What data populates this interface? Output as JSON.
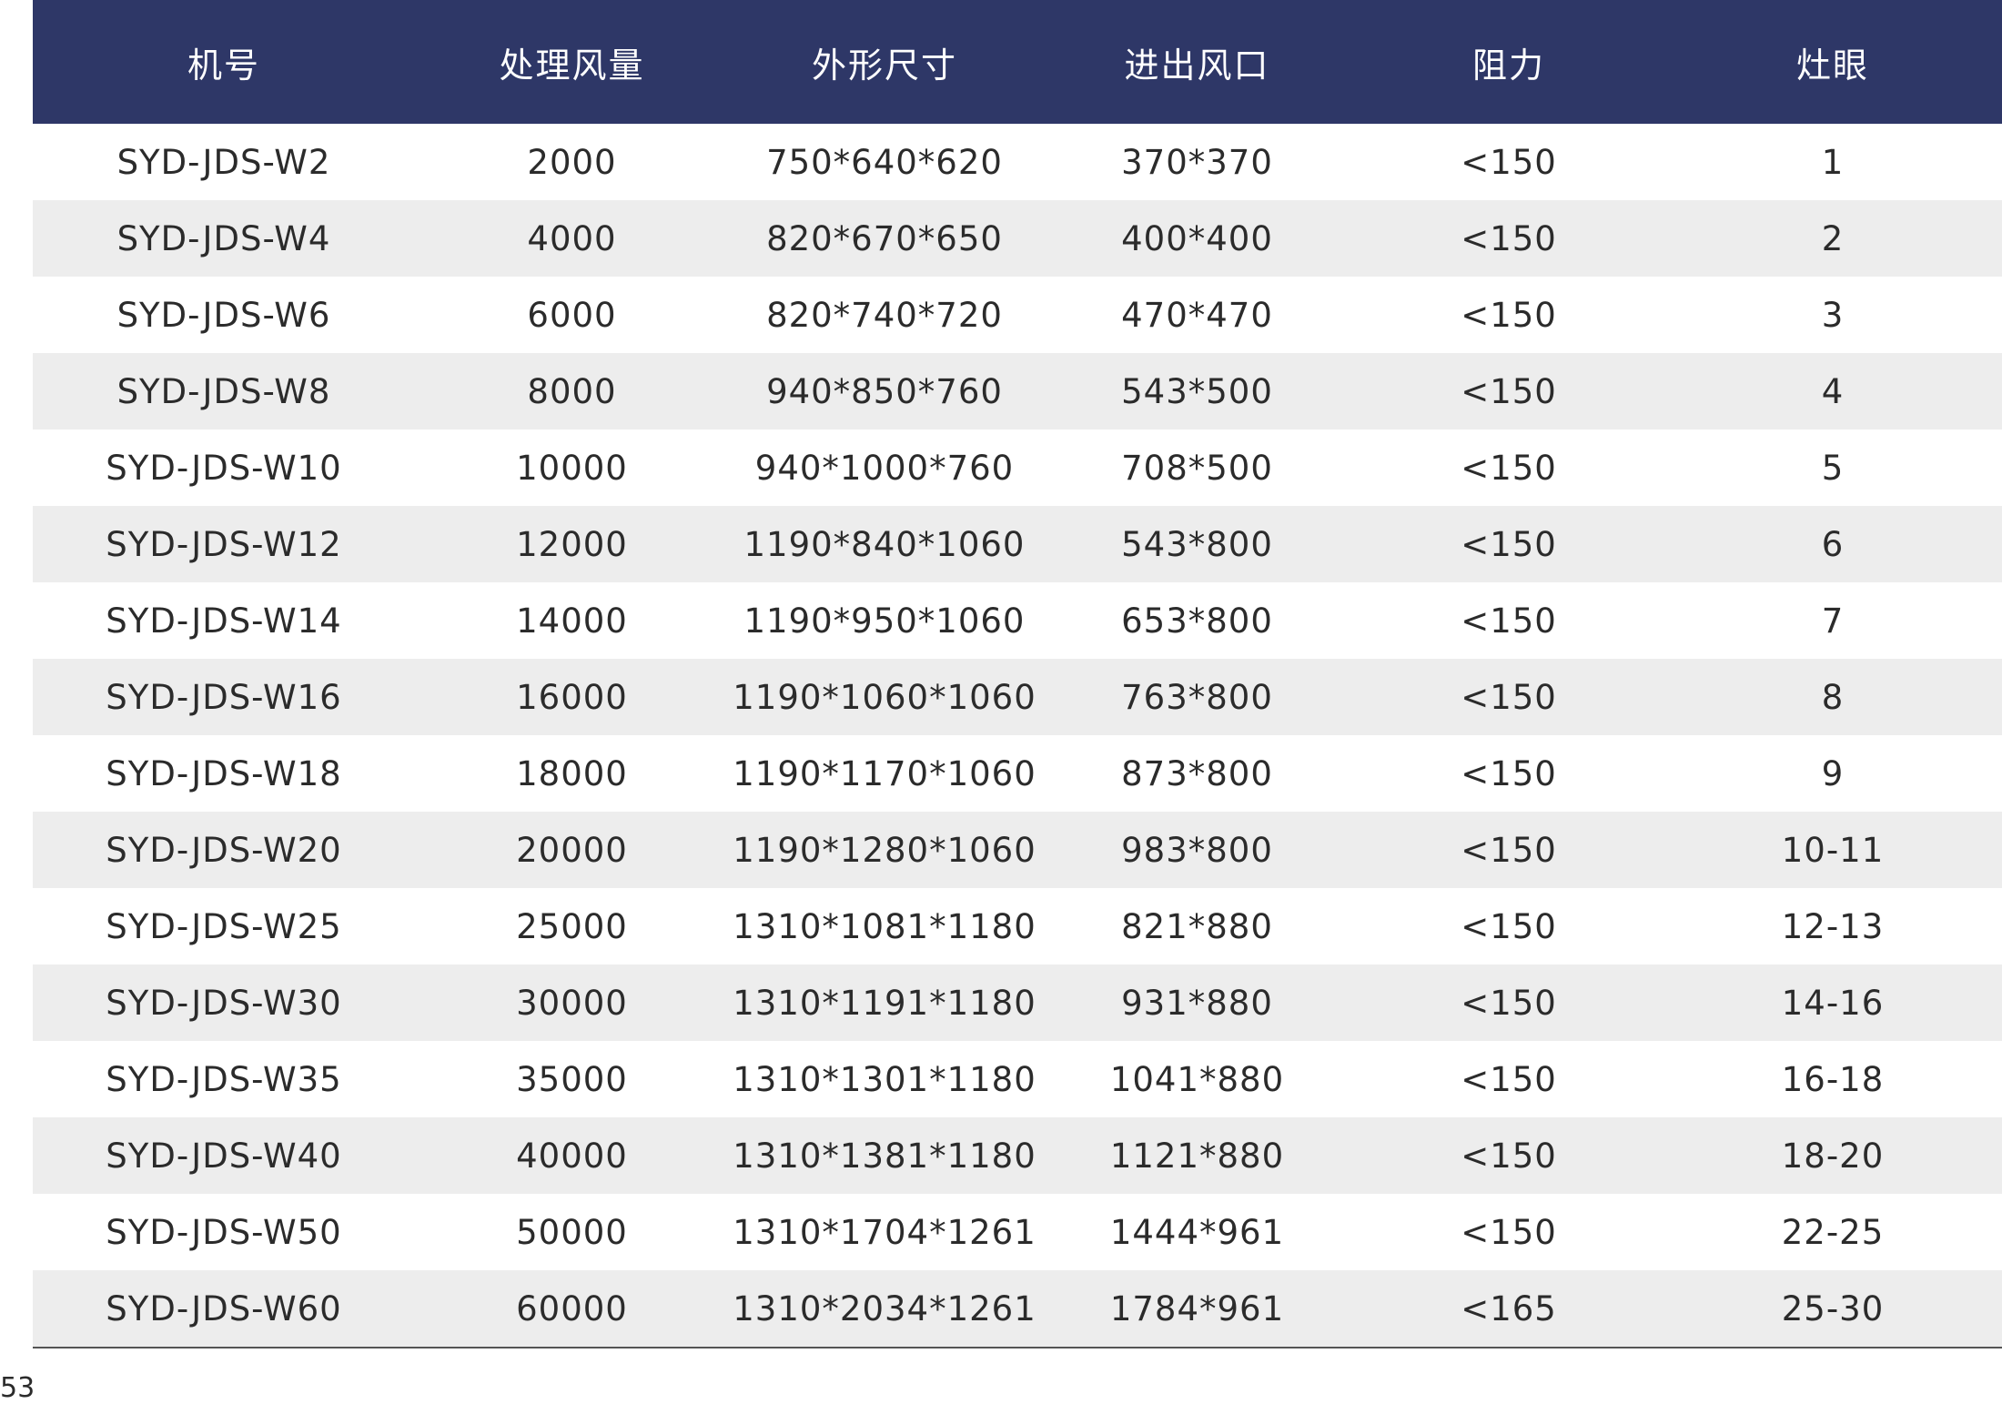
{
  "table": {
    "headers": [
      "机号",
      "处理风量",
      "外形尺寸",
      "进出风口",
      "阻力",
      "灶眼"
    ],
    "rows": [
      [
        "SYD-JDS-W2",
        "2000",
        "750*640*620",
        "370*370",
        "<150",
        "1"
      ],
      [
        "SYD-JDS-W4",
        "4000",
        "820*670*650",
        "400*400",
        "<150",
        "2"
      ],
      [
        "SYD-JDS-W6",
        "6000",
        "820*740*720",
        "470*470",
        "<150",
        "3"
      ],
      [
        "SYD-JDS-W8",
        "8000",
        "940*850*760",
        "543*500",
        "<150",
        "4"
      ],
      [
        "SYD-JDS-W10",
        "10000",
        "940*1000*760",
        "708*500",
        "<150",
        "5"
      ],
      [
        "SYD-JDS-W12",
        "12000",
        "1190*840*1060",
        "543*800",
        "<150",
        "6"
      ],
      [
        "SYD-JDS-W14",
        "14000",
        "1190*950*1060",
        "653*800",
        "<150",
        "7"
      ],
      [
        "SYD-JDS-W16",
        "16000",
        "1190*1060*1060",
        "763*800",
        "<150",
        "8"
      ],
      [
        "SYD-JDS-W18",
        "18000",
        "1190*1170*1060",
        "873*800",
        "<150",
        "9"
      ],
      [
        "SYD-JDS-W20",
        "20000",
        "1190*1280*1060",
        "983*800",
        "<150",
        "10-11"
      ],
      [
        "SYD-JDS-W25",
        "25000",
        "1310*1081*1180",
        "821*880",
        "<150",
        "12-13"
      ],
      [
        "SYD-JDS-W30",
        "30000",
        "1310*1191*1180",
        "931*880",
        "<150",
        "14-16"
      ],
      [
        "SYD-JDS-W35",
        "35000",
        "1310*1301*1180",
        "1041*880",
        "<150",
        "16-18"
      ],
      [
        "SYD-JDS-W40",
        "40000",
        "1310*1381*1180",
        "1121*880",
        "<150",
        "18-20"
      ],
      [
        "SYD-JDS-W50",
        "50000",
        "1310*1704*1261",
        "1444*961",
        "<150",
        "22-25"
      ],
      [
        "SYD-JDS-W60",
        "60000",
        "1310*2034*1261",
        "1784*961",
        "<165",
        "25-30"
      ]
    ]
  },
  "page_number": "53",
  "colors": {
    "header_bg": "#2e3767",
    "header_text": "#ffffff",
    "stripe_bg": "#ededed",
    "body_text": "#2b2b2b"
  }
}
